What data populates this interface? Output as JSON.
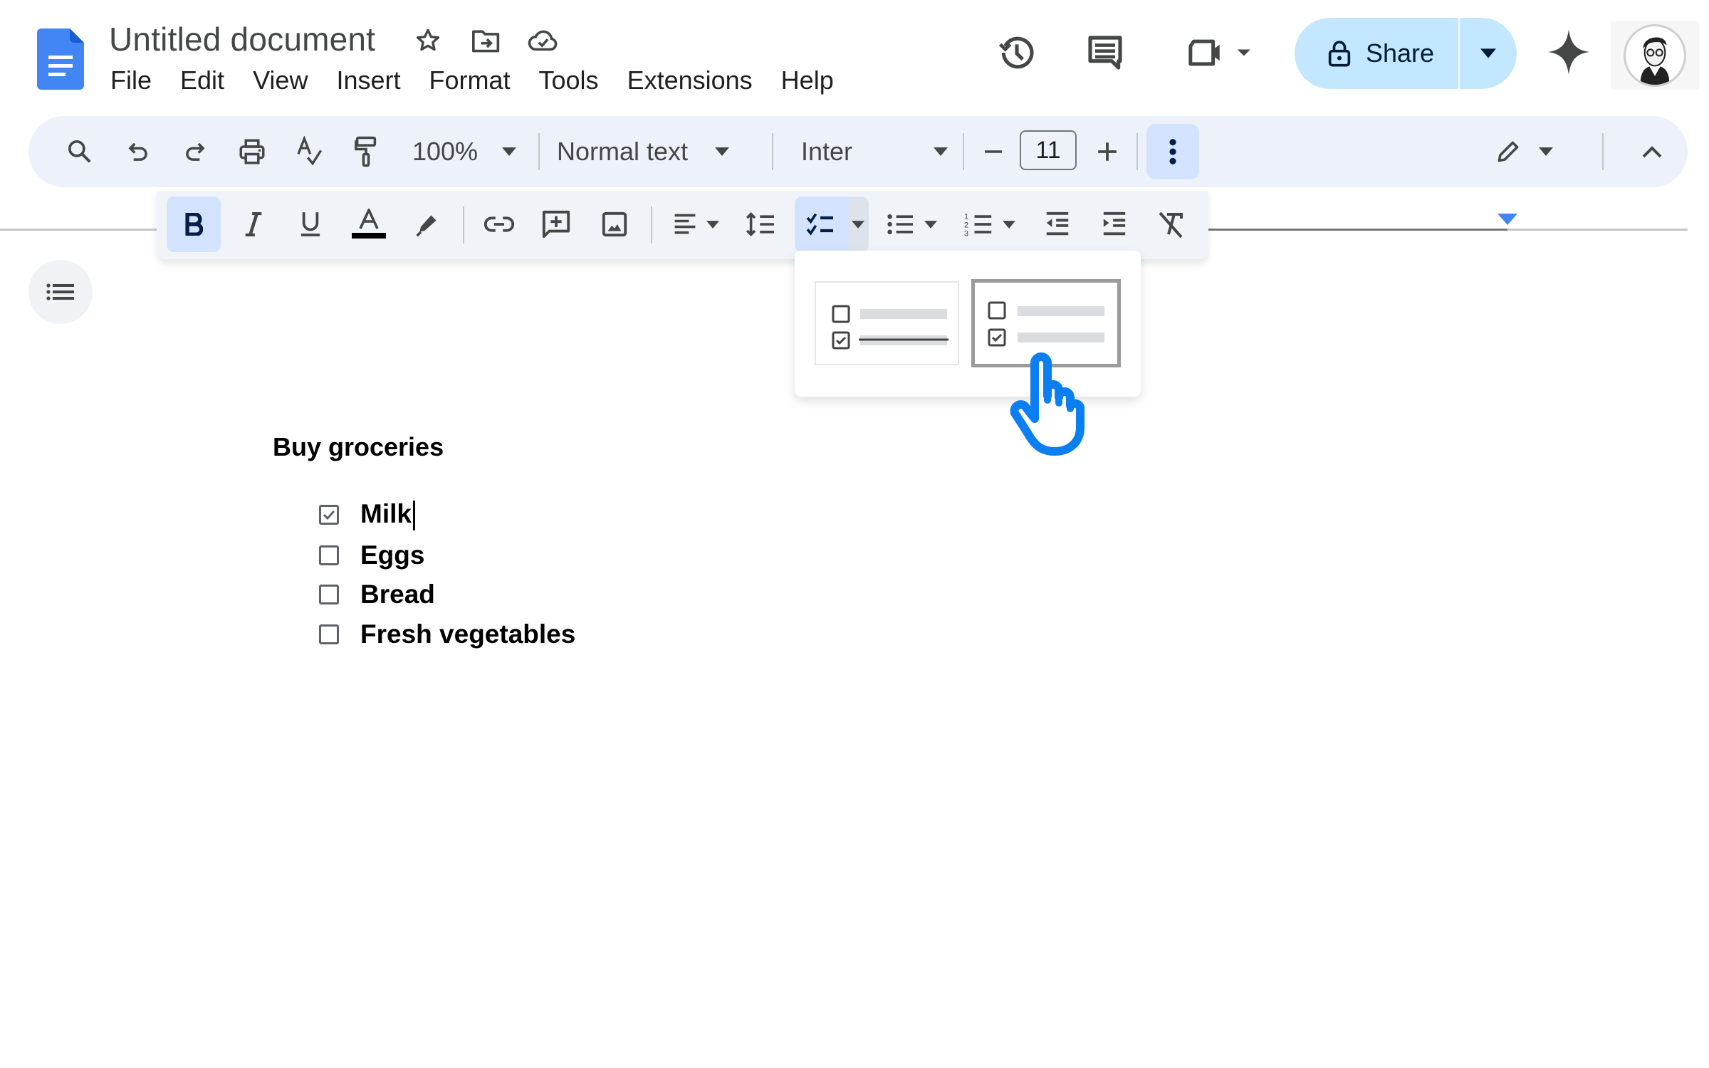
{
  "app": {
    "title": "Untitled document",
    "title_icons": [
      "star-icon",
      "move-to-folder-icon",
      "cloud-saved-icon"
    ]
  },
  "menu": {
    "items": [
      {
        "label": "File"
      },
      {
        "label": "Edit"
      },
      {
        "label": "View"
      },
      {
        "label": "Insert"
      },
      {
        "label": "Format"
      },
      {
        "label": "Tools"
      },
      {
        "label": "Extensions"
      },
      {
        "label": "Help"
      }
    ]
  },
  "header": {
    "share_label": "Share",
    "icons": [
      "version-history-icon",
      "comments-icon",
      "meet-icon",
      "gemini-icon",
      "avatar"
    ]
  },
  "toolbar": {
    "zoom": "100%",
    "paragraph_style": "Normal text",
    "font": "Inter",
    "font_size": "11",
    "decrease_label": "−",
    "increase_label": "+"
  },
  "format_bar": {
    "active": [
      "bold",
      "checklist"
    ]
  },
  "checklist_menu": {
    "options": [
      {
        "name": "checklist-with-strikethrough",
        "selected": false
      },
      {
        "name": "checklist-without-strikethrough",
        "selected": true
      }
    ]
  },
  "document": {
    "heading": "Buy groceries",
    "items": [
      {
        "label": "Milk",
        "checked": true
      },
      {
        "label": "Eggs",
        "checked": false
      },
      {
        "label": "Bread",
        "checked": false
      },
      {
        "label": "Fresh vegetables",
        "checked": false
      }
    ]
  },
  "colors": {
    "accent": "#1a73e8",
    "toolbar_bg": "#edf2fa",
    "active_btn": "#d3e3fd",
    "share_bg": "#c2e7ff",
    "cursor_blue": "#0b7ef2",
    "ruler_marker": "#4285f4"
  }
}
